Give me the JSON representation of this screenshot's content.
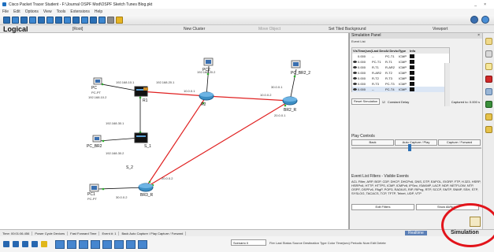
{
  "window": {
    "title": "Cisco Packet Tracer Student - F:\\Journal OSPF Mod\\OSPF Sketch Tunes Blog.pkt",
    "controls": [
      "_",
      "×"
    ]
  },
  "menu": [
    "File",
    "Edit",
    "Options",
    "View",
    "Tools",
    "Extensions",
    "Help"
  ],
  "workspace": {
    "mode": "Logical",
    "root": "[Root]",
    "new_cluster": "New Cluster",
    "move_object": "Move Object",
    "set_background": "Set Tiled Background",
    "viewport": "Viewport"
  },
  "devices": [
    {
      "name": "PC",
      "sub": "PC-PT"
    },
    {
      "name": "PC2",
      "sub": "PC-PT"
    },
    {
      "name": "PC_BR2",
      "sub": "PC-PT"
    },
    {
      "name": "PC_BR2_2",
      "sub": "PC-PT"
    },
    {
      "name": "PC1",
      "sub": "PC-PT"
    },
    {
      "name": "PC_BR3",
      "sub": "PC-PT"
    },
    {
      "name": "R1",
      "sub": "2811"
    },
    {
      "name": "R2",
      "sub": "2811"
    },
    {
      "name": "BR2_R",
      "sub": "2811"
    },
    {
      "name": "BR3_R",
      "sub": "2811"
    },
    {
      "name": "S_1",
      "sub": "2960"
    },
    {
      "name": "S_2",
      "sub": "2960"
    }
  ],
  "ip_labels": [
    "192.168.10.2",
    "192.168.10.1",
    "192.168.20.2",
    "192.168.20.1",
    "10.0.0.1",
    "10.0.0.2",
    "20.0.0.1",
    "20.0.0.2",
    "30.0.0.1",
    "30.0.0.2",
    "192.168.30.1",
    "192.168.30.2"
  ],
  "simulation_panel": {
    "title": "Simulation Panel",
    "event_list_label": "Event List",
    "columns": [
      "Vis.",
      "Time(sec)",
      "Last Device",
      "At Device",
      "Type",
      "Info"
    ],
    "events": [
      {
        "time": "0.000",
        "last": "--",
        "at": "PC-T1",
        "type": "ICMP"
      },
      {
        "time": "0.000",
        "last": "PC-T1",
        "at": "R-T1",
        "type": "ICMP"
      },
      {
        "time": "0.000",
        "last": "R-T1",
        "at": "R-AR2",
        "type": "ICMP"
      },
      {
        "time": "0.000",
        "last": "R-AR2",
        "at": "R-T2",
        "type": "ICMP"
      },
      {
        "time": "0.000",
        "last": "R-T2",
        "at": "R-T3",
        "type": "ICMP"
      },
      {
        "time": "0.000",
        "last": "R-T3",
        "at": "PC-T3",
        "type": "ICMP"
      },
      {
        "time": "0.000",
        "last": "--",
        "at": "PC-T4",
        "type": "ICMP"
      }
    ],
    "reset_label": "Reset Simulation",
    "constant_delay_label": "Constant Delay",
    "captured_label": "Captured to: 0.000 s",
    "play_controls_label": "Play Controls",
    "buttons": [
      "Back",
      "Auto Capture / Play",
      "Capture / Forward"
    ],
    "filters_title": "Event List Filters - Visible Events",
    "filters_text": "ACL Filter, ARP, BGP, CDP, DHCP, DHCPv6, DNS, DTP, EAPOL, EIGRP, FTP, H.323, HSRP, HSRPv6, HTTP, HTTPS, ICMP, ICMPv6, IPSec, ISAKMP, LACP, NDP, NETFLOW, NTP, OSPF, OSPFv6, PAgP, POP3, RADIUS, RIP, RIPng, RTP, SCCP, SMTP, SNMP, SSH, STP, SYSLOG, TACACS, TCP, TFTP, Telnet, UDP, VTP",
    "filter_buttons": [
      "Edit Filters",
      "Show All/None"
    ]
  },
  "status": {
    "time": "Time: 00:01:06.456",
    "power_cycle": "Power Cycle Devices",
    "fast_forward": "Fast Forward Time",
    "event": "Event #: 1",
    "play_status": "Back   Auto Capture / Play   Capture / Forward",
    "realtime": "Realtime",
    "simulation": "Simulation"
  },
  "bottom": {
    "scenario": "Scenario 0",
    "headers": "Fire   Last Status   Source   Destination   Type   Color   Time(sec)   Periodic   Num   Edit   Delete"
  },
  "colors": {
    "link_red": "#e02020",
    "annotation": "#e2141b",
    "accent": "#2a6fb5",
    "router": "#3d8fc4"
  }
}
